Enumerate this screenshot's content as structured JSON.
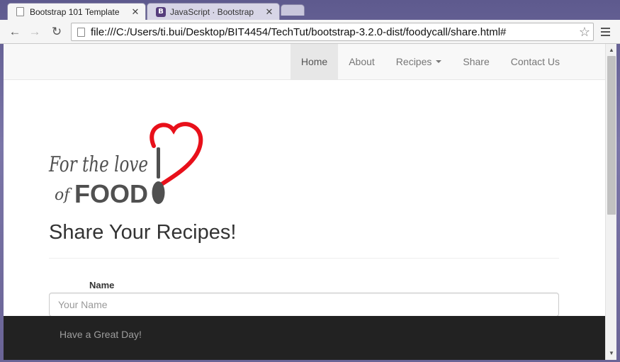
{
  "browser": {
    "tabs": [
      {
        "title": "Bootstrap 101 Template",
        "active": true
      },
      {
        "title": "JavaScript · Bootstrap",
        "active": false,
        "icon_letter": "B"
      }
    ],
    "url": "file:///C:/Users/ti.bui/Desktop/BIT4454/TechTut/bootstrap-3.2.0-dist/foodycall/share.html#",
    "icons": [
      "back-icon",
      "forward-icon",
      "reload-icon",
      "page-icon",
      "star-icon",
      "menu-icon"
    ]
  },
  "navbar": {
    "items": [
      {
        "label": "Home",
        "active": true
      },
      {
        "label": "About"
      },
      {
        "label": "Recipes",
        "dropdown": true
      },
      {
        "label": "Share"
      },
      {
        "label": "Contact Us"
      }
    ]
  },
  "logo": {
    "line1": "For the love",
    "line2_prefix": "of",
    "line2_main": "FOOD",
    "heart_color": "#e8101a",
    "text_color": "#505050"
  },
  "main": {
    "title": "Share Your Recipes!",
    "name_label": "Name",
    "name_placeholder": "Your Name"
  },
  "footer": {
    "text": "Have a Great Day!"
  },
  "colors": {
    "navbar_bg": "#f8f8f8",
    "footer_bg": "#222222",
    "active_nav_bg": "#e7e7e7"
  }
}
